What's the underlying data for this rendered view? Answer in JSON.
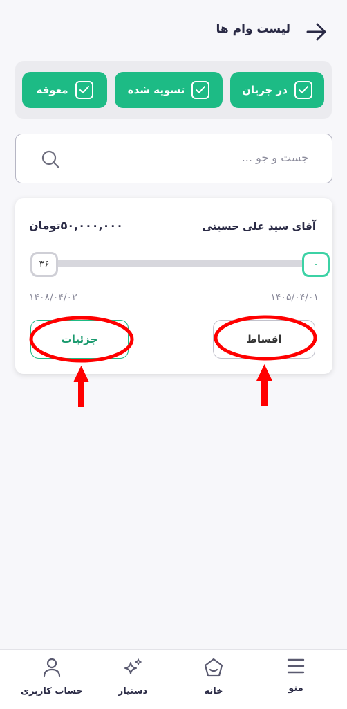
{
  "header": {
    "title": "لیست وام ها"
  },
  "filters": [
    {
      "label": "در جریان",
      "checked": true
    },
    {
      "label": "تسویه شده",
      "checked": true
    },
    {
      "label": "معوقه",
      "checked": true
    }
  ],
  "search": {
    "placeholder": "جست و جو ..."
  },
  "loan": {
    "borrower": "آقای سید علی حسینی",
    "amount": "۵۰,۰۰۰,۰۰۰تومان",
    "paid_installments": "۰",
    "total_installments": "۳۶",
    "progress": 0,
    "start_date": "۱۴۰۵/۰۴/۰۱",
    "end_date": "۱۴۰۸/۰۴/۰۲",
    "installments_label": "اقساط",
    "details_label": "جزئیات"
  },
  "nav": {
    "menu": "منو",
    "home": "خانه",
    "assistant": "دستیار",
    "account": "حساب کاربری"
  },
  "colors": {
    "accent": "#1dbb85",
    "annotation": "#ff0000"
  }
}
